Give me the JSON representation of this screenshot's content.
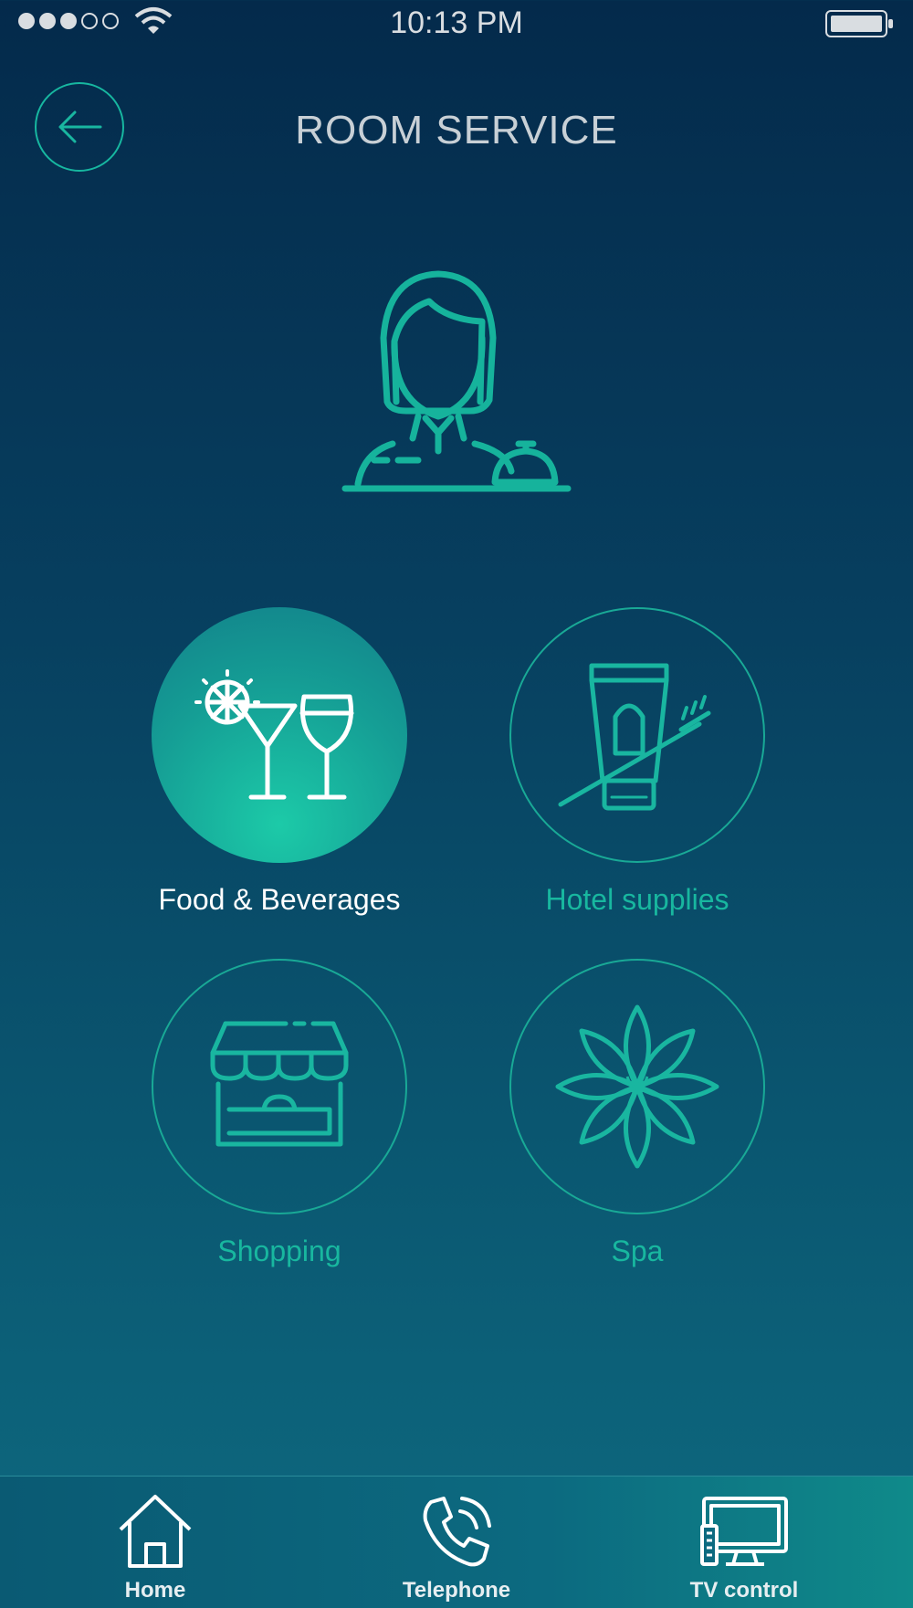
{
  "status_bar": {
    "time": "10:13 PM",
    "signal_filled": 3,
    "signal_total": 5,
    "icons": [
      "signal-dots",
      "wifi-icon",
      "battery-icon"
    ]
  },
  "header": {
    "title": "ROOM SERVICE",
    "back_icon": "arrow-left-icon"
  },
  "hero": {
    "icon": "concierge-icon"
  },
  "services": [
    {
      "label": "Food & Beverages",
      "icon": "drinks-icon",
      "selected": true
    },
    {
      "label": "Hotel supplies",
      "icon": "toiletries-icon",
      "selected": false
    },
    {
      "label": "Shopping",
      "icon": "storefront-icon",
      "selected": false
    },
    {
      "label": "Spa",
      "icon": "lotus-icon",
      "selected": false
    }
  ],
  "tab_bar": {
    "items": [
      {
        "label": "Home",
        "icon": "home-icon"
      },
      {
        "label": "Telephone",
        "icon": "phone-icon"
      },
      {
        "label": "TV control",
        "icon": "tv-icon"
      }
    ]
  },
  "colors": {
    "accent": "#19b6a0",
    "background_top": "#042a4b",
    "background_bottom": "#0e6a80",
    "active_label": "#ffffff"
  }
}
